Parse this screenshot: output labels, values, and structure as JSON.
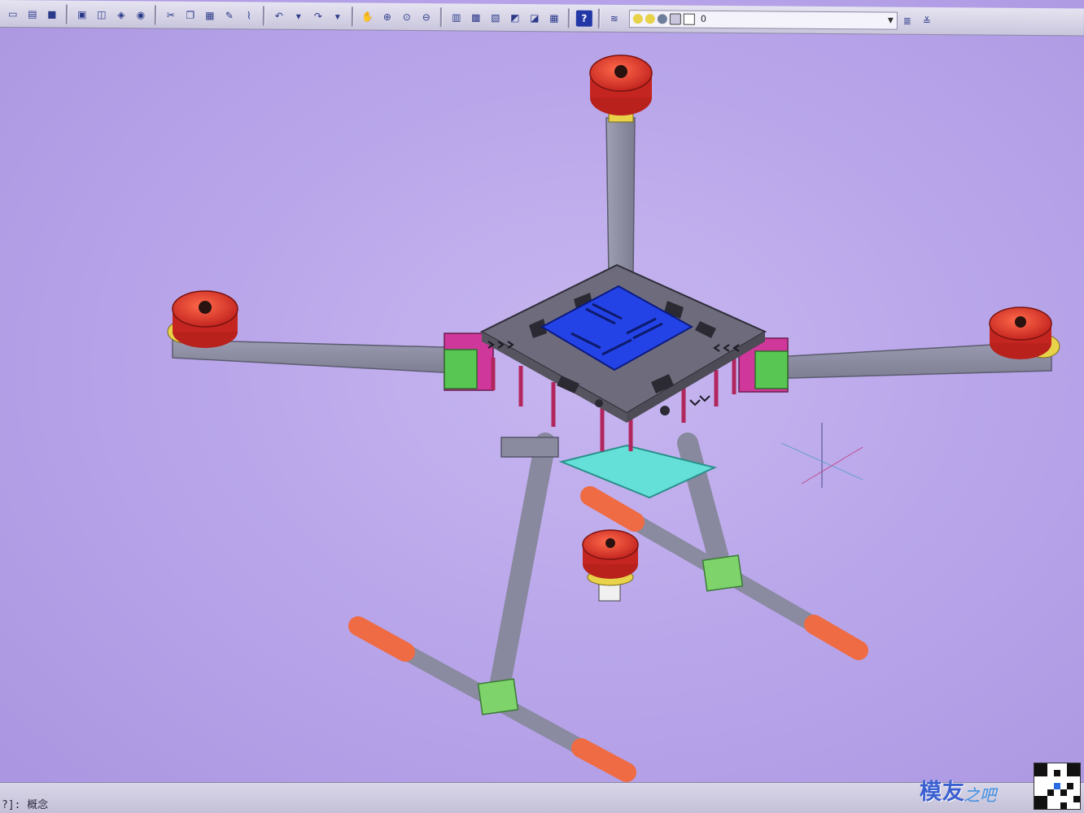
{
  "toolbar": {
    "icons": [
      "new-icon",
      "open-icon",
      "save-icon",
      "print-icon",
      "preview-icon",
      "publish-icon",
      "plot-icon",
      "cut-icon",
      "copy-icon",
      "paste-icon",
      "match-icon",
      "undo-icon",
      "redo-icon",
      "pan-icon",
      "zoom-realtime-icon",
      "zoom-window-icon",
      "zoom-previous-icon",
      "properties-icon",
      "design-center-icon",
      "tool-palette-icon",
      "sheet-set-icon",
      "markup-icon",
      "calculator-icon",
      "help-icon"
    ],
    "help_label": "?",
    "layer": {
      "name": "0",
      "swatch_colors": [
        "#e8d24a",
        "#6f7e9a",
        "#2a2a2a"
      ]
    }
  },
  "statusbar": {
    "command_prompt": "?]: 概念"
  },
  "watermark": {
    "text": "模友",
    "sub": "之吧"
  },
  "colors": {
    "background": "#b9a6ea",
    "arm": "#8f8fa3",
    "motor": "#d8312a",
    "plate": "#6e6c7c",
    "top_plate": "#2343e6",
    "bracket": "#58c653",
    "skid_cap": "#ef6b43",
    "bottom_plate": "#64e0d8"
  }
}
